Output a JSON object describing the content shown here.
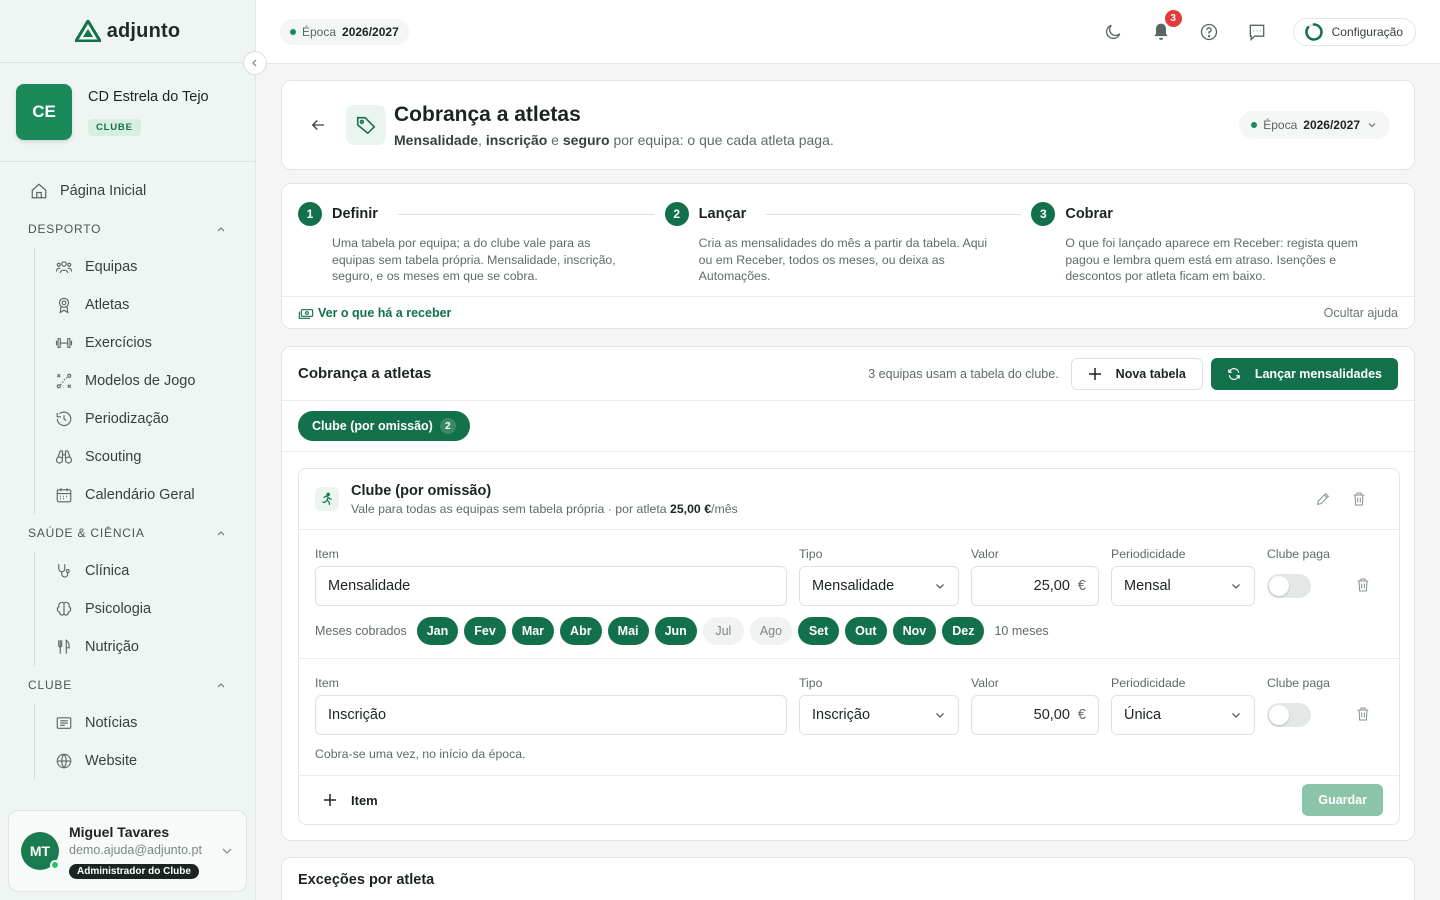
{
  "app": {
    "brand": "adjunto"
  },
  "sidebar": {
    "club": {
      "initials": "CE",
      "name": "CD Estrela do Tejo",
      "badge": "CLUBE"
    },
    "home_label": "Página Inicial",
    "sections": [
      {
        "title": "DESPORTO",
        "items": [
          {
            "label": "Equipas",
            "icon": "users-icon"
          },
          {
            "label": "Atletas",
            "icon": "award-icon"
          },
          {
            "label": "Exercícios",
            "icon": "dumbbell-icon"
          },
          {
            "label": "Modelos de Jogo",
            "icon": "tactics-icon"
          },
          {
            "label": "Periodização",
            "icon": "history-icon"
          },
          {
            "label": "Scouting",
            "icon": "binoculars-icon"
          },
          {
            "label": "Calendário Geral",
            "icon": "calendar-icon"
          }
        ]
      },
      {
        "title": "SAÚDE & CIÊNCIA",
        "items": [
          {
            "label": "Clínica",
            "icon": "stethoscope-icon"
          },
          {
            "label": "Psicologia",
            "icon": "brain-icon"
          },
          {
            "label": "Nutrição",
            "icon": "utensils-icon"
          }
        ]
      },
      {
        "title": "CLUBE",
        "items": [
          {
            "label": "Notícias",
            "icon": "newspaper-icon"
          },
          {
            "label": "Website",
            "icon": "globe-icon"
          }
        ]
      }
    ],
    "user": {
      "initials": "MT",
      "name": "Miguel Tavares",
      "email": "demo.ajuda@adjunto.pt",
      "role": "Administrador do Clube"
    }
  },
  "topbar": {
    "season_prefix": "Época",
    "season_value": "2026/2027",
    "notifications_count": "3",
    "config_label": "Configuração"
  },
  "page": {
    "title": "Cobrança a atletas",
    "subtitle_parts": [
      "Mensalidade",
      ", ",
      "inscrição",
      " e ",
      "seguro",
      " por equipa: o que cada atleta paga."
    ],
    "season_prefix": "Época",
    "season_value": "2026/2027"
  },
  "steps": [
    {
      "num": "1",
      "title": "Definir",
      "desc": "Uma tabela por equipa; a do clube vale para as equipas sem tabela própria. Mensalidade, inscrição, seguro, e os meses em que se cobra."
    },
    {
      "num": "2",
      "title": "Lançar",
      "desc": "Cria as mensalidades do mês a partir da tabela. Aqui ou em Receber, todos os meses, ou deixa as Automações."
    },
    {
      "num": "3",
      "title": "Cobrar",
      "desc": "O que foi lançado aparece em Receber: regista quem pagou e lembra quem está em atraso. Isenções e descontos por atleta ficam em baixo."
    }
  ],
  "steps_footer": {
    "link": "Ver o que há a receber",
    "hide": "Ocultar ajuda"
  },
  "billing": {
    "title": "Cobrança a atletas",
    "info": "3 equipas usam a tabela do clube.",
    "new_table": "Nova tabela",
    "launch": "Lançar mensalidades",
    "tab_label": "Clube (por omissão)",
    "tab_count": "2",
    "table": {
      "title": "Clube (por omissão)",
      "sub_prefix": "Vale para todas as equipas sem tabela própria · por atleta ",
      "sub_amount": "25,00 €",
      "sub_suffix": "/mês",
      "labels": {
        "item": "Item",
        "type": "Tipo",
        "value": "Valor",
        "period": "Periodicidade",
        "club_pays": "Clube paga"
      },
      "rows": [
        {
          "item": "Mensalidade",
          "type": "Mensalidade",
          "value": "25,00",
          "currency": "€",
          "period": "Mensal",
          "club_pays": false
        },
        {
          "item": "Inscrição",
          "type": "Inscrição",
          "value": "50,00",
          "currency": "€",
          "period": "Única",
          "club_pays": false,
          "note": "Cobra-se uma vez, no início da época."
        }
      ],
      "months_label": "Meses cobrados",
      "months": [
        {
          "label": "Jan",
          "on": true
        },
        {
          "label": "Fev",
          "on": true
        },
        {
          "label": "Mar",
          "on": true
        },
        {
          "label": "Abr",
          "on": true
        },
        {
          "label": "Mai",
          "on": true
        },
        {
          "label": "Jun",
          "on": true
        },
        {
          "label": "Jul",
          "on": false
        },
        {
          "label": "Ago",
          "on": false
        },
        {
          "label": "Set",
          "on": true
        },
        {
          "label": "Out",
          "on": true
        },
        {
          "label": "Nov",
          "on": true
        },
        {
          "label": "Dez",
          "on": true
        }
      ],
      "months_count": "10 meses",
      "add_item": "Item",
      "save": "Guardar"
    }
  },
  "exceptions": {
    "title": "Exceções por atleta"
  },
  "colors": {
    "brand": "#12704a",
    "accent": "#1a8a5a",
    "notification": "#e23b3b"
  }
}
